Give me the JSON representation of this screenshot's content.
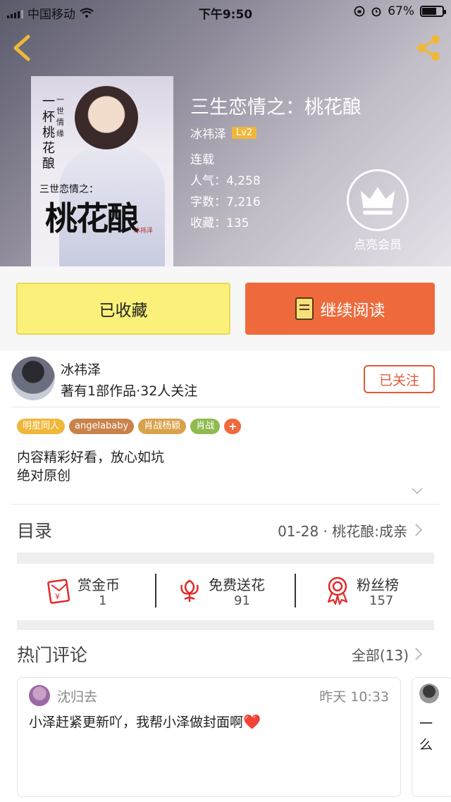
{
  "status_bar": {
    "carrier": "中国移动",
    "time": "下午9:50",
    "battery": "67%",
    "battery_level": 0.67
  },
  "book": {
    "title": "三生恋情之：桃花酿",
    "author": "冰祎泽",
    "level": "Lv2",
    "status": "连载",
    "popularity_label": "人气：",
    "popularity": "4,258",
    "words_label": "字数：",
    "words": "7,216",
    "favorites_label": "收藏：",
    "favorites": "135",
    "vip_label": "点亮会员",
    "cover": {
      "series_text": "三世恋情之：",
      "big_title": "桃花酿",
      "vertical_text": "一杯桃花酿",
      "vertical_text_2": "一世情缘",
      "author_tag": "冰祎泽"
    }
  },
  "buttons": {
    "favorited": "已收藏",
    "continue_reading": "继续阅读"
  },
  "author_info": {
    "name": "冰祎泽",
    "works": "著有1部作品·32人关注",
    "follow": "已关注"
  },
  "tags": [
    {
      "label": "明星同人",
      "color": "#f0b73a"
    },
    {
      "label": "angelababy",
      "color": "#c9824a"
    },
    {
      "label": "肖战杨颖",
      "color": "#d8a24a"
    },
    {
      "label": "肖战",
      "color": "#8fba4e"
    },
    {
      "label": "+",
      "color": "#ee6a3c"
    }
  ],
  "description": {
    "line1": "内容精彩好看，放心如坑",
    "line2": "绝对原创"
  },
  "toc": {
    "label": "目录",
    "latest": "01-28 · 桃花酿:成亲"
  },
  "stats": [
    {
      "label": "赏金币",
      "value": "1",
      "icon": "red-envelope-icon"
    },
    {
      "label": "免费送花",
      "value": "91",
      "icon": "flower-icon"
    },
    {
      "label": "粉丝榜",
      "value": "157",
      "icon": "medal-icon"
    }
  ],
  "comments": {
    "label": "热门评论",
    "all": "全部(13)",
    "items": [
      {
        "user": "沈归去",
        "time": "昨天 10:33",
        "text": "小泽赶紧更新吖，我帮小泽做封面啊",
        "emoji": "❤️"
      },
      {
        "user": "",
        "time": "",
        "text": "一么"
      }
    ]
  },
  "colors": {
    "accent_orange": "#ee6a3c",
    "favorite_yellow": "#fbf17a",
    "follow_red": "#e05a3a",
    "level_gold": "#f0b73a"
  }
}
